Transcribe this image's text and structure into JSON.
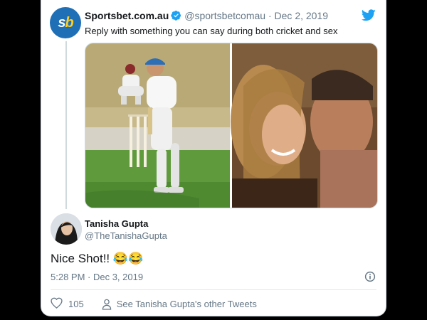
{
  "parent_tweet": {
    "avatar_text": "sb",
    "name": "Sportsbet.com.au",
    "handle": "@sportsbetcomau",
    "separator": "·",
    "date": "Dec 2, 2019",
    "text": "Reply with something you can say during both cricket and sex",
    "media_left": "cricket-batsman-photo",
    "media_right": "couple-photo"
  },
  "reply_tweet": {
    "name": "Tanisha Gupta",
    "handle": "@TheTanishaGupta",
    "text": "Nice Shot!! 😂😂",
    "meta": "5:28 PM · Dec 3, 2019",
    "like_count": "105",
    "user_link": "See Tanisha Gupta's other Tweets"
  },
  "colors": {
    "brand_blue": "#1da1f2",
    "sportsbet_blue": "#1f6fb6",
    "secondary_text": "#657786"
  }
}
